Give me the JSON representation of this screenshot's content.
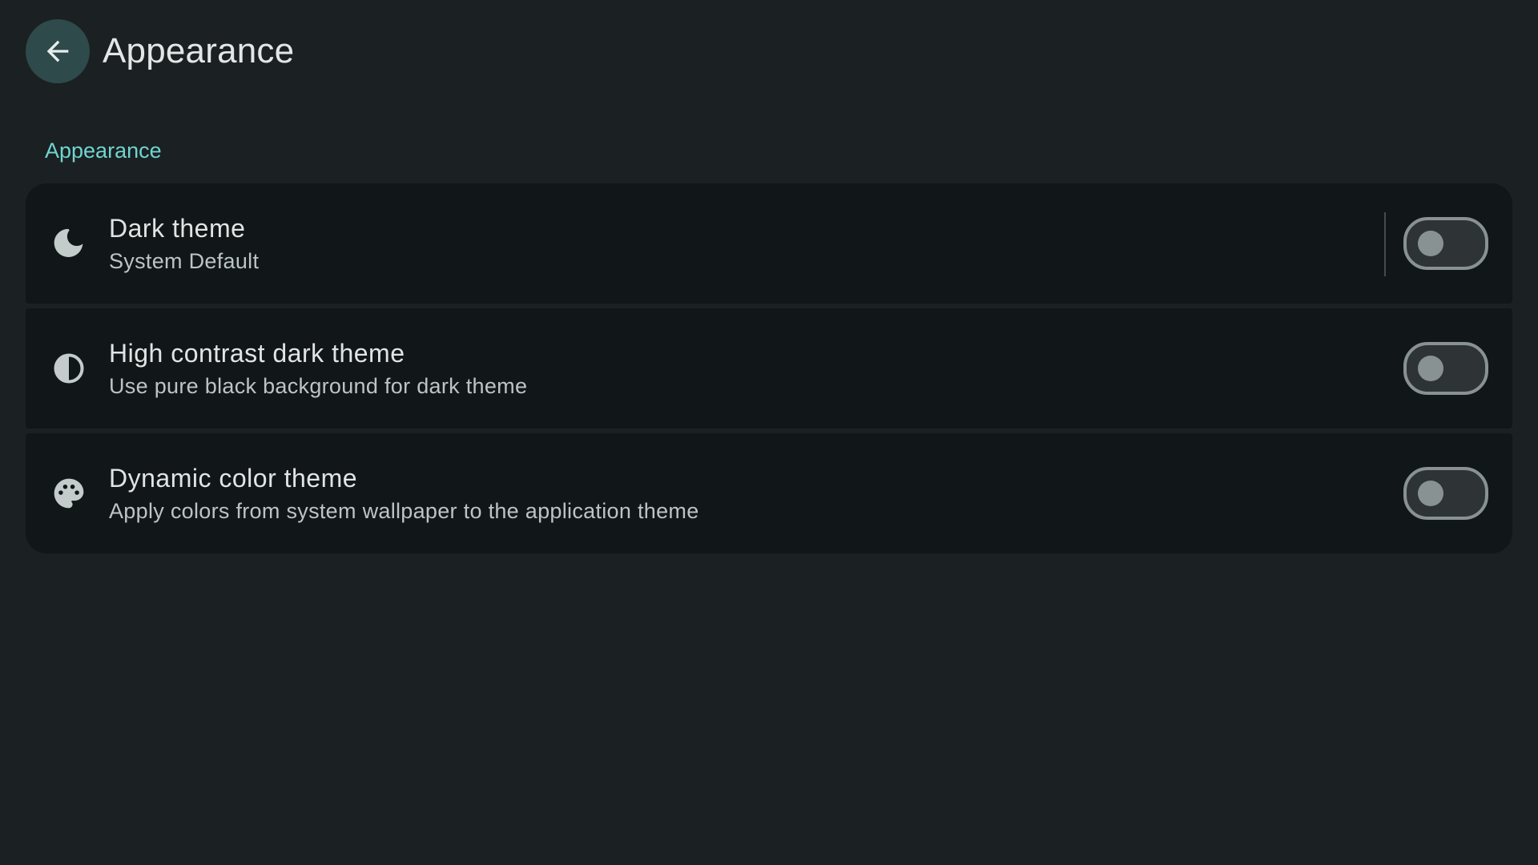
{
  "header": {
    "title": "Appearance",
    "back_icon": "arrow-back-icon"
  },
  "section": {
    "label": "Appearance"
  },
  "settings": [
    {
      "icon": "moon-icon",
      "title": "Dark theme",
      "subtitle": "System Default",
      "enabled": false
    },
    {
      "icon": "contrast-icon",
      "title": "High contrast dark theme",
      "subtitle": "Use pure black background for dark theme",
      "enabled": false
    },
    {
      "icon": "palette-icon",
      "title": "Dynamic color theme",
      "subtitle": "Apply colors from system wallpaper to the application theme",
      "enabled": false
    }
  ],
  "colors": {
    "background": "#1b2022",
    "card": "#111718",
    "accent": "#6fd5cf",
    "back_button": "#2e4a4a",
    "switch_outline": "#899292"
  }
}
